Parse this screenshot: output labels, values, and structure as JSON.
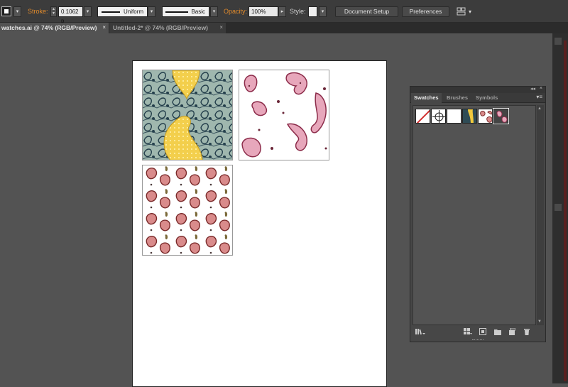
{
  "controlbar": {
    "fill_icon": "fill-stroke-swatch",
    "stroke_label": "Stroke:",
    "stroke_weight": "0.1062 p",
    "profile_uniform": "Uniform",
    "brush_basic": "Basic",
    "opacity_label": "Opacity:",
    "opacity_value": "100%",
    "style_label": "Style:",
    "document_setup": "Document Setup",
    "preferences": "Preferences"
  },
  "tabs": [
    {
      "label": "watches.ai @ 74% (RGB/Preview)",
      "close": "×",
      "active": true
    },
    {
      "label": "Untitled-2* @ 74% (RGB/Preview)",
      "close": "×",
      "active": false
    }
  ],
  "panel": {
    "collapse": "◂◂",
    "close": "×",
    "tabs": [
      "Swatches",
      "Brushes",
      "Symbols"
    ],
    "menu": "▾≡",
    "swatches": [
      {
        "name": "None"
      },
      {
        "name": "Registration"
      },
      {
        "name": "White"
      },
      {
        "name": "Paisley Yellow"
      },
      {
        "name": "Paisley Red Grid"
      },
      {
        "name": "Paisley Pink"
      }
    ]
  },
  "colors": {
    "accent_orange": "#e08a2c",
    "paisley_teal": "#7f9c94",
    "paisley_yellow": "#f1c93d",
    "paisley_pink": "#c76b86",
    "paisley_red": "#9c3a3a"
  }
}
